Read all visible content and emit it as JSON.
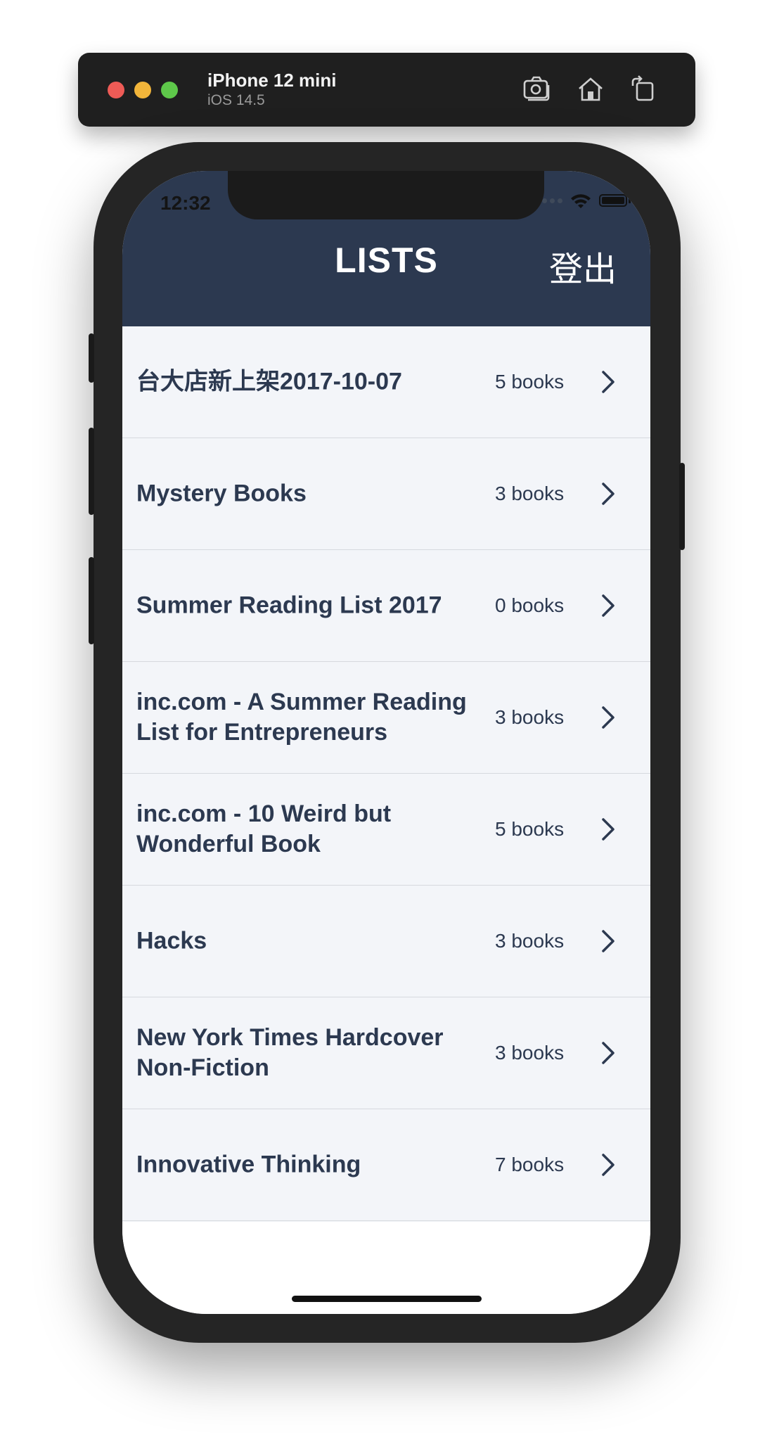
{
  "simulator": {
    "device_name": "iPhone 12 mini",
    "os_version": "iOS 14.5",
    "icons": [
      "screenshot-icon",
      "home-icon",
      "rotate-icon"
    ]
  },
  "status_bar": {
    "time": "12:32"
  },
  "navbar": {
    "title": "LISTS",
    "logout_label": "登出",
    "background_color": "#2c3950"
  },
  "lists": [
    {
      "title": "台大店新上架2017-10-07",
      "count": "5 books"
    },
    {
      "title": "Mystery Books",
      "count": "3 books"
    },
    {
      "title": "Summer Reading List 2017",
      "count": "0 books"
    },
    {
      "title": "inc.com - A Summer Reading List for Entrepreneurs",
      "count": "3 books"
    },
    {
      "title": "inc.com - 10 Weird but Wonderful Book",
      "count": "5 books"
    },
    {
      "title": "Hacks",
      "count": "3 books"
    },
    {
      "title": "New York Times Hardcover Non-Fiction",
      "count": "3 books"
    },
    {
      "title": "Innovative Thinking",
      "count": "7 books"
    }
  ]
}
